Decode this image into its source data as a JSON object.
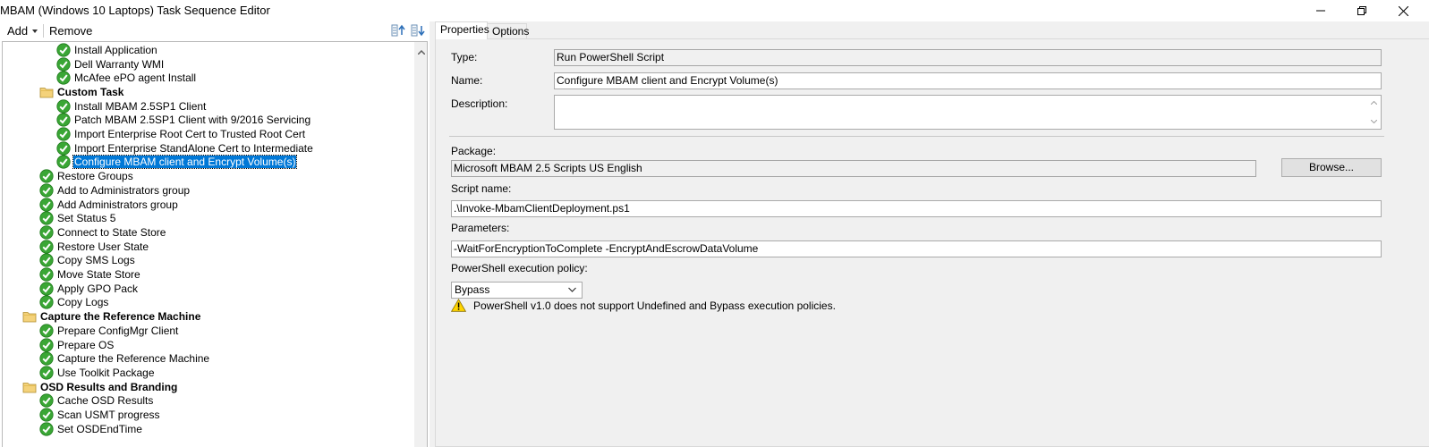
{
  "window": {
    "title": "MBAM (Windows 10 Laptops) Task Sequence Editor"
  },
  "toolbar": {
    "add_label": "Add",
    "remove_label": "Remove"
  },
  "tree": {
    "items": [
      {
        "label": "Install Application",
        "type": "step",
        "indent": 2
      },
      {
        "label": "Dell Warranty WMI",
        "type": "step",
        "indent": 2
      },
      {
        "label": "McAfee ePO agent Install",
        "type": "step",
        "indent": 2
      },
      {
        "label": "Custom Task",
        "type": "group",
        "indent": 1
      },
      {
        "label": "Install MBAM 2.5SP1 Client",
        "type": "step",
        "indent": 2
      },
      {
        "label": "Patch MBAM 2.5SP1 Client with 9/2016 Servicing",
        "type": "step",
        "indent": 2
      },
      {
        "label": "Import Enterprise Root Cert to Trusted Root Cert",
        "type": "step",
        "indent": 2
      },
      {
        "label": "Import Enterprise StandAlone Cert to Intermediate",
        "type": "step",
        "indent": 2
      },
      {
        "label": "Configure MBAM client and Encrypt Volume(s)",
        "type": "step",
        "indent": 2,
        "selected": true
      },
      {
        "label": "Restore Groups",
        "type": "step",
        "indent": 1
      },
      {
        "label": "Add                     to Administrators group",
        "type": "step",
        "indent": 1
      },
      {
        "label": "Add                   Administrators group",
        "type": "step",
        "indent": 1
      },
      {
        "label": "Set Status 5",
        "type": "step",
        "indent": 1
      },
      {
        "label": "Connect to State Store",
        "type": "step",
        "indent": 1
      },
      {
        "label": "Restore User State",
        "type": "step",
        "indent": 1
      },
      {
        "label": "Copy SMS Logs",
        "type": "step",
        "indent": 1
      },
      {
        "label": "Move State Store",
        "type": "step",
        "indent": 1
      },
      {
        "label": "Apply GPO Pack",
        "type": "step",
        "indent": 1
      },
      {
        "label": "Copy Logs",
        "type": "step",
        "indent": 1
      },
      {
        "label": "Capture the Reference Machine",
        "type": "group",
        "indent": 0
      },
      {
        "label": "Prepare ConfigMgr Client",
        "type": "step",
        "indent": 1
      },
      {
        "label": "Prepare OS",
        "type": "step",
        "indent": 1
      },
      {
        "label": "Capture the Reference Machine",
        "type": "step",
        "indent": 1
      },
      {
        "label": "Use Toolkit Package",
        "type": "step",
        "indent": 1
      },
      {
        "label": "OSD Results and Branding",
        "type": "group",
        "indent": 0
      },
      {
        "label": "Cache OSD Results",
        "type": "step",
        "indent": 1
      },
      {
        "label": "Scan USMT progress",
        "type": "step",
        "indent": 1
      },
      {
        "label": "Set OSDEndTime",
        "type": "step",
        "indent": 1
      }
    ]
  },
  "tabs": [
    {
      "label": "Properties",
      "active": true
    },
    {
      "label": "Options",
      "active": false
    }
  ],
  "properties": {
    "type_label": "Type:",
    "type_value": "Run PowerShell Script",
    "name_label": "Name:",
    "name_value": "Configure MBAM client and Encrypt Volume(s)",
    "description_label": "Description:",
    "description_value": "",
    "package_label": "Package:",
    "package_value": "Microsoft MBAM 2.5 Scripts  US English",
    "browse_label": "Browse...",
    "script_label": "Script name:",
    "script_value": ".\\Invoke-MbamClientDeployment.ps1",
    "parameters_label": "Parameters:",
    "parameters_value": "-WaitForEncryptionToComplete -EncryptAndEscrowDataVolume",
    "policy_label": "PowerShell execution policy:",
    "policy_value": "Bypass",
    "warning_text": "PowerShell v1.0 does not support Undefined and Bypass execution policies."
  },
  "colors": {
    "selection": "#0078d7",
    "check_green": "#3aa635",
    "folder_yellow": "#f4d27a",
    "warning_yellow": "#ffd400"
  }
}
